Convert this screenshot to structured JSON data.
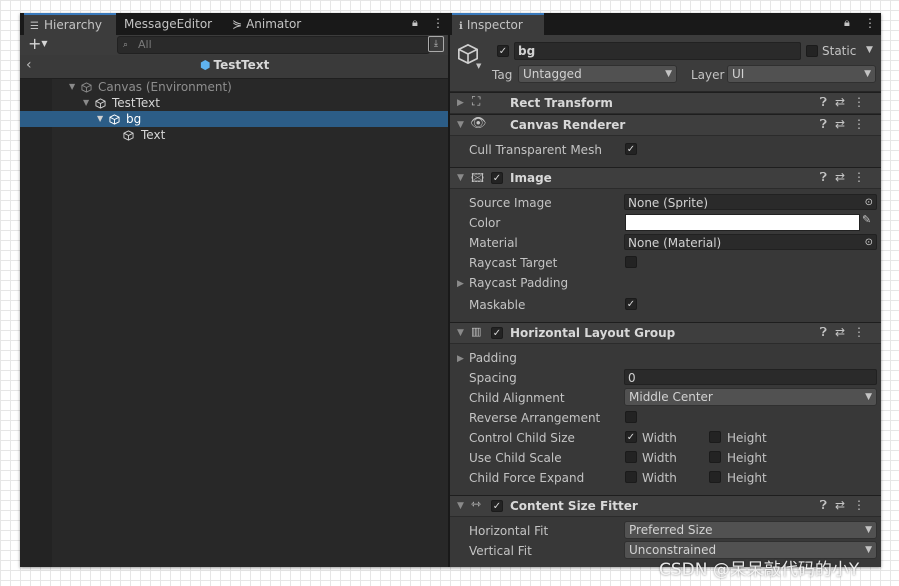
{
  "hierarchy": {
    "tabs": [
      {
        "label": "Hierarchy"
      },
      {
        "label": "MessageEditor"
      },
      {
        "label": "Animator"
      }
    ],
    "add_label": "+",
    "search_placeholder": "All",
    "prefab_title": "TestText",
    "tree": [
      {
        "label": "Canvas (Environment)"
      },
      {
        "label": "TestText"
      },
      {
        "label": "bg"
      },
      {
        "label": "Text"
      }
    ]
  },
  "inspector": {
    "tab_label": "Inspector",
    "object": {
      "name": "bg",
      "active": true,
      "static_label": "Static",
      "tag_label": "Tag",
      "tag_value": "Untagged",
      "layer_label": "Layer",
      "layer_value": "UI"
    },
    "rect_transform": {
      "title": "Rect Transform"
    },
    "canvas_renderer": {
      "title": "Canvas Renderer",
      "cull_label": "Cull Transparent Mesh",
      "cull_checked": true
    },
    "image": {
      "title": "Image",
      "enabled": true,
      "source_image_label": "Source Image",
      "source_image_value": "None (Sprite)",
      "color_label": "Color",
      "color_value": "#ffffff",
      "material_label": "Material",
      "material_value": "None (Material)",
      "raycast_target_label": "Raycast Target",
      "raycast_target_checked": false,
      "raycast_padding_label": "Raycast Padding",
      "maskable_label": "Maskable",
      "maskable_checked": true
    },
    "hlg": {
      "title": "Horizontal Layout Group",
      "enabled": true,
      "padding_label": "Padding",
      "spacing_label": "Spacing",
      "spacing_value": "0",
      "child_alignment_label": "Child Alignment",
      "child_alignment_value": "Middle Center",
      "reverse_label": "Reverse Arrangement",
      "control_child_size_label": "Control Child Size",
      "use_child_scale_label": "Use Child Scale",
      "child_force_expand_label": "Child Force Expand",
      "width_label": "Width",
      "height_label": "Height"
    },
    "csf": {
      "title": "Content Size Fitter",
      "enabled": true,
      "horizontal_fit_label": "Horizontal Fit",
      "horizontal_fit_value": "Preferred Size",
      "vertical_fit_label": "Vertical Fit",
      "vertical_fit_value": "Unconstrained"
    }
  },
  "watermark": "CSDN @呆呆敲代码的小Y",
  "colors": {
    "selection": "#2c5d87",
    "accent": "#3a79bb",
    "prefab_icon": "#5fb3f0"
  }
}
